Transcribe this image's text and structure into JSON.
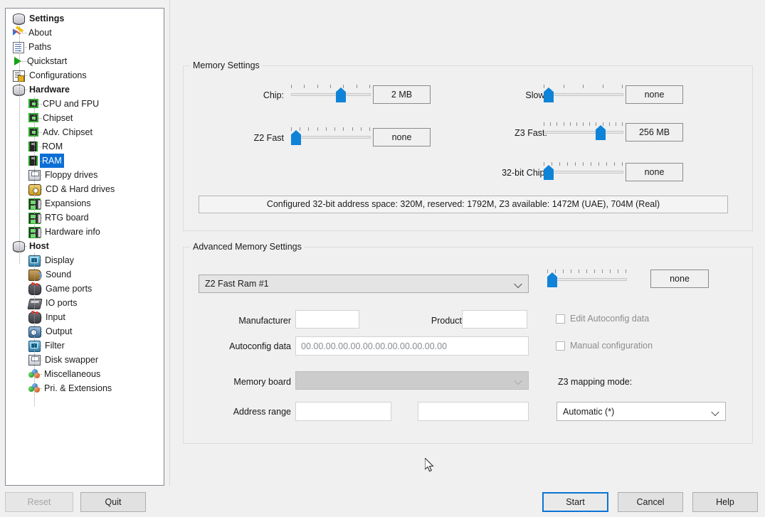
{
  "tree": {
    "items": [
      {
        "label": "Settings",
        "icon": "stack-icon",
        "level": 0,
        "bold": true,
        "selected": false
      },
      {
        "label": "About",
        "icon": "pen-check-icon",
        "level": 1,
        "bold": false,
        "selected": false
      },
      {
        "label": "Paths",
        "icon": "paths-icon",
        "level": 1,
        "bold": false,
        "selected": false
      },
      {
        "label": "Quickstart",
        "icon": "play-icon",
        "level": 1,
        "bold": false,
        "selected": false
      },
      {
        "label": "Configurations",
        "icon": "config-list-icon",
        "level": 1,
        "bold": false,
        "selected": false
      },
      {
        "label": "Hardware",
        "icon": "stack-icon",
        "level": 1,
        "bold": true,
        "selected": false
      },
      {
        "label": "CPU and FPU",
        "icon": "chip-icon",
        "level": 2,
        "bold": false,
        "selected": false
      },
      {
        "label": "Chipset",
        "icon": "chip-icon",
        "level": 2,
        "bold": false,
        "selected": false
      },
      {
        "label": "Adv. Chipset",
        "icon": "chip-icon",
        "level": 2,
        "bold": false,
        "selected": false
      },
      {
        "label": "ROM",
        "icon": "ram-stick-icon",
        "level": 2,
        "bold": false,
        "selected": false
      },
      {
        "label": "RAM",
        "icon": "ram-stick-icon",
        "level": 2,
        "bold": false,
        "selected": true
      },
      {
        "label": "Floppy drives",
        "icon": "floppy-icon",
        "level": 2,
        "bold": false,
        "selected": false
      },
      {
        "label": "CD & Hard drives",
        "icon": "cd-icon",
        "level": 2,
        "bold": false,
        "selected": false
      },
      {
        "label": "Expansions",
        "icon": "expansion-card-icon",
        "level": 2,
        "bold": false,
        "selected": false
      },
      {
        "label": "RTG board",
        "icon": "expansion-card-icon",
        "level": 2,
        "bold": false,
        "selected": false
      },
      {
        "label": "Hardware info",
        "icon": "expansion-card-icon",
        "level": 2,
        "bold": false,
        "selected": false
      },
      {
        "label": "Host",
        "icon": "stack-icon",
        "level": 1,
        "bold": true,
        "selected": false
      },
      {
        "label": "Display",
        "icon": "monitor-icon",
        "level": 2,
        "bold": false,
        "selected": false
      },
      {
        "label": "Sound",
        "icon": "sound-icon",
        "level": 2,
        "bold": false,
        "selected": false
      },
      {
        "label": "Game ports",
        "icon": "joystick-icon",
        "level": 2,
        "bold": false,
        "selected": false
      },
      {
        "label": "IO ports",
        "icon": "io-ports-icon",
        "level": 2,
        "bold": false,
        "selected": false
      },
      {
        "label": "Input",
        "icon": "joystick-icon",
        "level": 2,
        "bold": false,
        "selected": false
      },
      {
        "label": "Output",
        "icon": "output-icon",
        "level": 2,
        "bold": false,
        "selected": false
      },
      {
        "label": "Filter",
        "icon": "monitor-icon",
        "level": 2,
        "bold": false,
        "selected": false
      },
      {
        "label": "Disk swapper",
        "icon": "floppy-icon",
        "level": 2,
        "bold": false,
        "selected": false
      },
      {
        "label": "Miscellaneous",
        "icon": "balls-icon",
        "level": 2,
        "bold": false,
        "selected": false
      },
      {
        "label": "Pri. & Extensions",
        "icon": "balls-icon",
        "level": 2,
        "bold": false,
        "selected": false
      }
    ]
  },
  "memory_settings": {
    "legend": "Memory Settings",
    "sliders": [
      {
        "name": "chip",
        "label": "Chip:",
        "value": "2 MB",
        "ticks": 7,
        "thumb_pct": 64
      },
      {
        "name": "z2fast",
        "label": "Z2 Fast",
        "value": "none",
        "ticks": 10,
        "thumb_pct": 0
      },
      {
        "name": "slow",
        "label": "Slow:",
        "value": "none",
        "ticks": 5,
        "thumb_pct": 0
      },
      {
        "name": "z3fast",
        "label": "Z3 Fast:",
        "value": "256 MB",
        "ticks": 13,
        "thumb_pct": 74
      },
      {
        "name": "chip32",
        "label": "32-bit Chip:",
        "value": "none",
        "ticks": 11,
        "thumb_pct": 0
      }
    ],
    "info": "Configured 32-bit address space: 320M, reserved: 1792M, Z3 available: 1472M (UAE), 704M (Real)"
  },
  "advanced_memory_settings": {
    "legend": "Advanced Memory Settings",
    "board_select": "Z2 Fast Ram #1",
    "board_slider": {
      "value": "none",
      "ticks": 11,
      "thumb_pct": 0
    },
    "manufacturer_label": "Manufacturer",
    "manufacturer_value": "",
    "product_label": "Product",
    "product_value": "",
    "autoconfig_label": "Autoconfig data",
    "autoconfig_value": "00.00.00.00.00.00.00.00.00.00.00.00",
    "memory_board_label": "Memory board",
    "memory_board_value": "",
    "address_range_label": "Address range",
    "address_range_start": "",
    "address_range_end": "",
    "edit_autoconfig_label": "Edit Autoconfig data",
    "edit_autoconfig_checked": false,
    "manual_config_label": "Manual configuration",
    "manual_config_checked": false,
    "z3_mapping_label": "Z3 mapping mode:",
    "z3_mapping_value": "Automatic (*)"
  },
  "footer": {
    "reset": "Reset",
    "quit": "Quit",
    "start": "Start",
    "cancel": "Cancel",
    "help": "Help"
  },
  "colors": {
    "accent": "#0f83d8",
    "selection": "#0c6fd6",
    "window_bg": "#f0f0f0",
    "focus_border": "#0a74d4"
  }
}
